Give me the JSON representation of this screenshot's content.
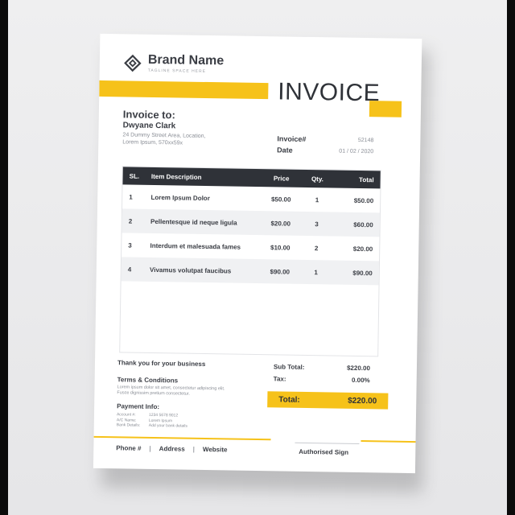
{
  "brand": {
    "name": "Brand Name",
    "tagline": "TAGLINE SPACE HERE"
  },
  "title": "INVOICE",
  "invoice_to": {
    "label": "Invoice to:",
    "name": "Dwyane Clark",
    "address": "24 Dummy Street Area, Location, Lorem Ipsum, 570xx59x"
  },
  "meta": {
    "invoice_label": "Invoice#",
    "invoice_value": "52148",
    "date_label": "Date",
    "date_value": "01 / 02 / 2020"
  },
  "table": {
    "headers": [
      "SL.",
      "Item Description",
      "Price",
      "Qty.",
      "Total"
    ],
    "rows": [
      {
        "sl": "1",
        "desc": "Lorem Ipsum Dolor",
        "price": "$50.00",
        "qty": "1",
        "total": "$50.00"
      },
      {
        "sl": "2",
        "desc": "Pellentesque id neque ligula",
        "price": "$20.00",
        "qty": "3",
        "total": "$60.00"
      },
      {
        "sl": "3",
        "desc": "Interdum et malesuada fames",
        "price": "$10.00",
        "qty": "2",
        "total": "$20.00"
      },
      {
        "sl": "4",
        "desc": "Vivamus volutpat faucibus",
        "price": "$90.00",
        "qty": "1",
        "total": "$90.00"
      }
    ]
  },
  "thanks": "Thank you for your business",
  "terms": {
    "title": "Terms & Conditions",
    "text": "Lorem ipsum dolor sit amet, consectetur adipiscing elit. Fusce dignissim pretium consectetur."
  },
  "payment": {
    "title": "Payment Info:",
    "account_label": "Account #:",
    "account_value": "1234 5678 9012",
    "ac_name_label": "A/C Name:",
    "ac_name_value": "Lorem Ipsum",
    "bank_label": "Bank Details:",
    "bank_value": "Add your bank details"
  },
  "sums": {
    "subtotal_label": "Sub Total:",
    "subtotal_value": "$220.00",
    "tax_label": "Tax:",
    "tax_value": "0.00%",
    "total_label": "Total:",
    "total_value": "$220.00"
  },
  "footer": {
    "phone": "Phone #",
    "address": "Address",
    "website": "Website",
    "separator": "|",
    "sign": "Authorised Sign"
  },
  "colors": {
    "accent": "#f6c21a",
    "dark": "#2f3238"
  }
}
